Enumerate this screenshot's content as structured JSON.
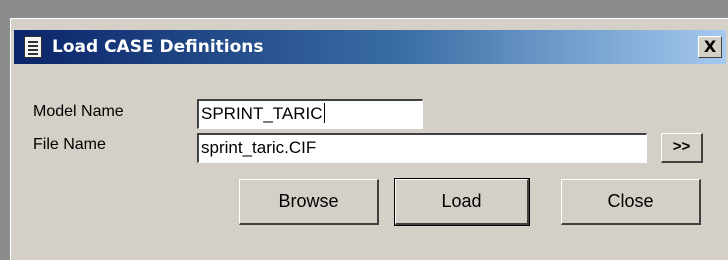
{
  "window": {
    "title": "Load CASE Definitions",
    "title_icon": "document-icon",
    "close_glyph": "X"
  },
  "form": {
    "model_label": "Model Name",
    "model_value": "SPRINT_TARIC",
    "file_label": "File Name",
    "file_value": "sprint_taric.CIF",
    "more_glyph": ">>"
  },
  "buttons": {
    "browse": "Browse",
    "load": "Load",
    "close": "Close"
  },
  "colors": {
    "titlebar_start": "#0a246a",
    "titlebar_end": "#a6caf0",
    "dialog_face": "#d4d0c8"
  }
}
